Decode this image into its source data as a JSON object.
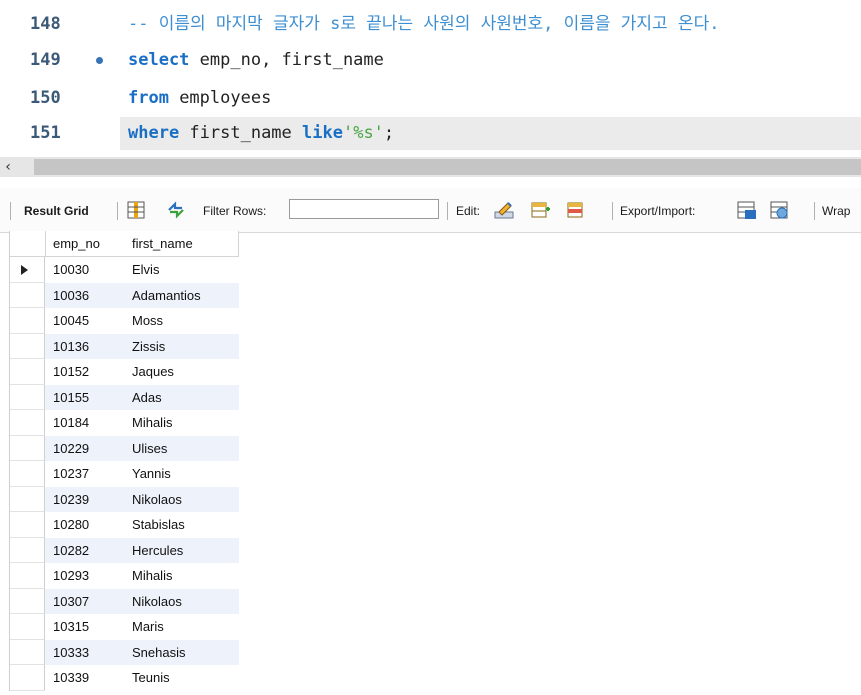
{
  "editor": {
    "lines": [
      {
        "number": "148",
        "comment": "-- 이름의 마지막 글자가 s로 끝나는 사원의 사원번호, 이름을 가지고 온다."
      },
      {
        "number": "149",
        "kw": "select",
        "rest": " emp_no, first_name"
      },
      {
        "number": "150",
        "kw": "from",
        "rest": " employees"
      },
      {
        "number": "151",
        "kw": "where",
        "mid": " first_name ",
        "kw2": "like",
        "str": "'%s'",
        "end": ";"
      }
    ]
  },
  "toolbar": {
    "result_grid": "Result Grid",
    "filter_rows": "Filter Rows:",
    "filter_value": "",
    "edit": "Edit:",
    "export_import": "Export/Import:",
    "wrap": "Wrap"
  },
  "grid": {
    "columns": [
      "emp_no",
      "first_name"
    ],
    "rows": [
      [
        "10030",
        "Elvis"
      ],
      [
        "10036",
        "Adamantios"
      ],
      [
        "10045",
        "Moss"
      ],
      [
        "10136",
        "Zissis"
      ],
      [
        "10152",
        "Jaques"
      ],
      [
        "10155",
        "Adas"
      ],
      [
        "10184",
        "Mihalis"
      ],
      [
        "10229",
        "Ulises"
      ],
      [
        "10237",
        "Yannis"
      ],
      [
        "10239",
        "Nikolaos"
      ],
      [
        "10280",
        "Stabislas"
      ],
      [
        "10282",
        "Hercules"
      ],
      [
        "10293",
        "Mihalis"
      ],
      [
        "10307",
        "Nikolaos"
      ],
      [
        "10315",
        "Maris"
      ],
      [
        "10333",
        "Snehasis"
      ],
      [
        "10339",
        "Teunis"
      ]
    ]
  },
  "colors": {
    "keyword": "#1a6fc4",
    "string": "#4aa544",
    "comment": "#3e8fd1",
    "alt_row": "#eef2fb"
  }
}
